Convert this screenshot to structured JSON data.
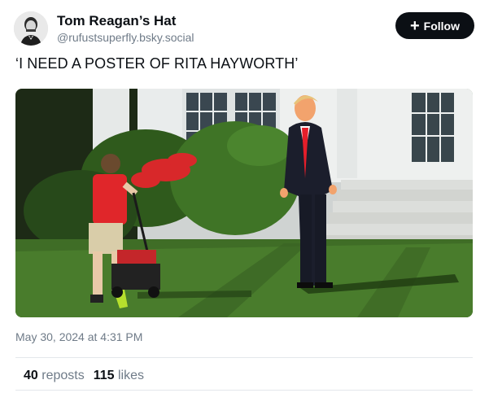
{
  "author": {
    "display_name": "Tom Reagan’s Hat",
    "handle": "@rufustsuperfly.bsky.social",
    "avatar_icon": "user-avatar"
  },
  "follow_button": {
    "label": "Follow",
    "icon": "plus-icon"
  },
  "post": {
    "text": "‘I NEED A POSTER OF RITA HAYWORTH’",
    "image_description_icon": "photo-man-in-suit-boy-mowing-lawn",
    "timestamp": "May 30, 2024 at 4:31 PM"
  },
  "stats": {
    "reposts_count": "40",
    "reposts_label": "reposts",
    "likes_count": "115",
    "likes_label": "likes"
  },
  "colors": {
    "text": "#0b0f14",
    "muted": "#6f7b88",
    "button_bg": "#0b0f14",
    "divider": "#e4e7eb"
  }
}
